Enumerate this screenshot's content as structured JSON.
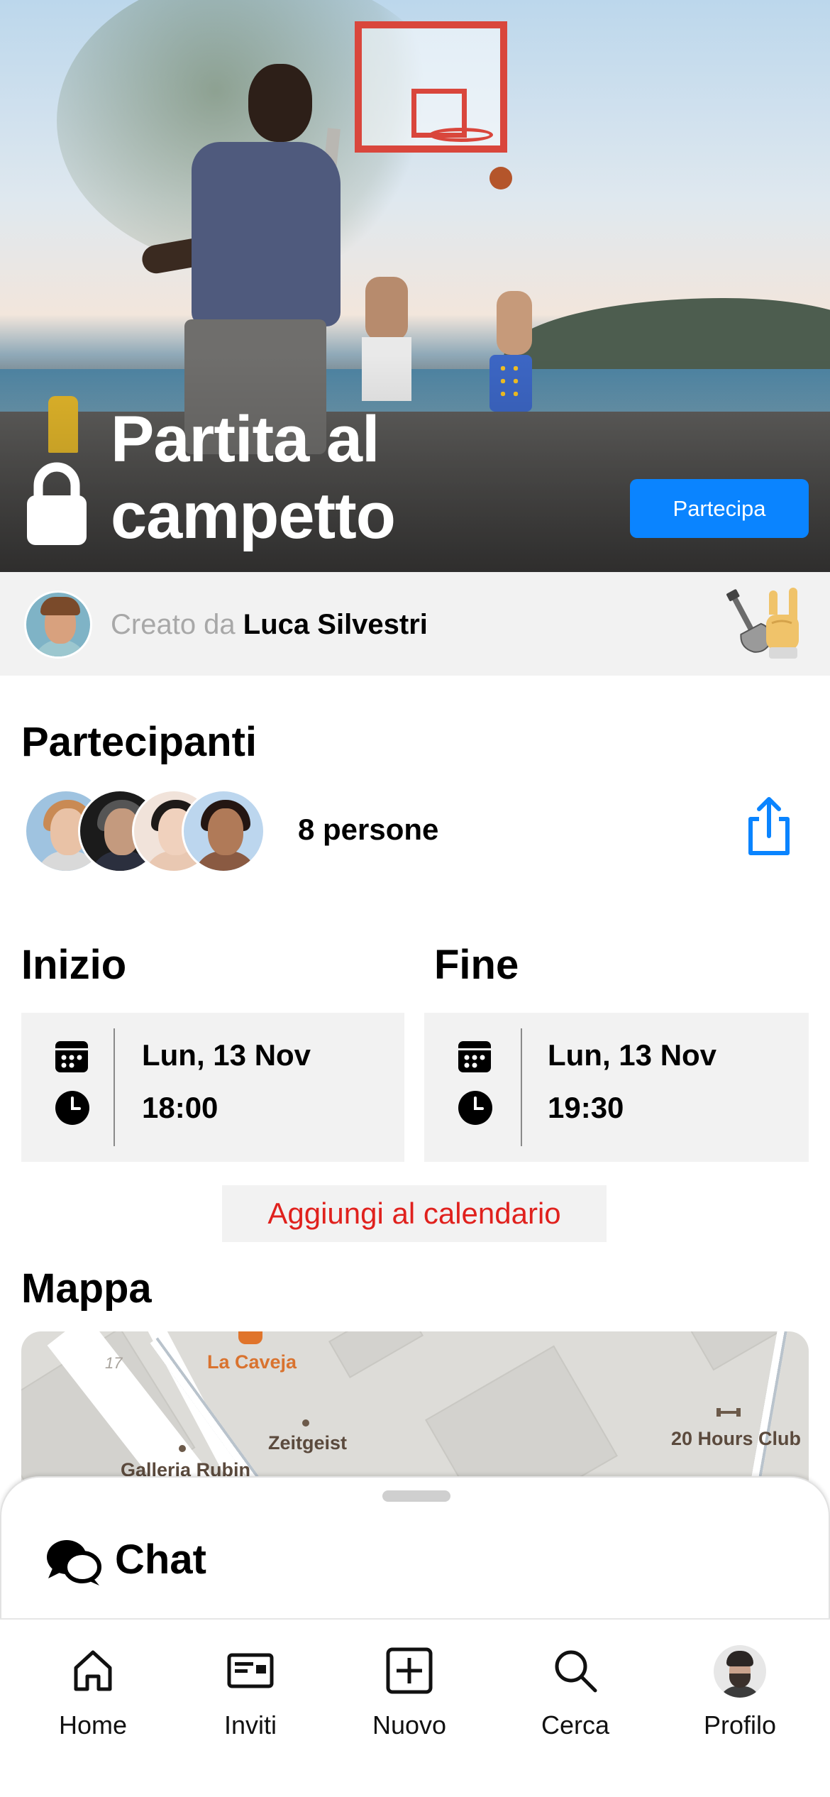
{
  "event": {
    "title": "Partita al campetto",
    "join_label": "Partecipa",
    "creator_prefix": "Creato da",
    "creator_name": "Luca Silvestri"
  },
  "participants": {
    "heading": "Partecipanti",
    "count_label": "8 persone"
  },
  "start": {
    "heading": "Inizio",
    "date": "Lun, 13 Nov",
    "time": "18:00"
  },
  "end": {
    "heading": "Fine",
    "date": "Lun, 13 Nov",
    "time": "19:30"
  },
  "add_calendar_label": "Aggiungi al calendario",
  "map": {
    "heading": "Mappa",
    "places": [
      "La Caveja",
      "Zeitgeist",
      "Galleria Rubin",
      "20 Hours Club"
    ],
    "street_number": "17"
  },
  "chat": {
    "title": "Chat"
  },
  "tabs": [
    {
      "label": "Home",
      "icon": "home-icon"
    },
    {
      "label": "Inviti",
      "icon": "ticket-icon"
    },
    {
      "label": "Nuovo",
      "icon": "plus-square-icon"
    },
    {
      "label": "Cerca",
      "icon": "search-icon"
    },
    {
      "label": "Profilo",
      "icon": "profile-avatar"
    }
  ],
  "colors": {
    "accent_blue": "#0a84ff",
    "calendar_red": "#e0211d",
    "card_gray": "#f2f2f2"
  }
}
